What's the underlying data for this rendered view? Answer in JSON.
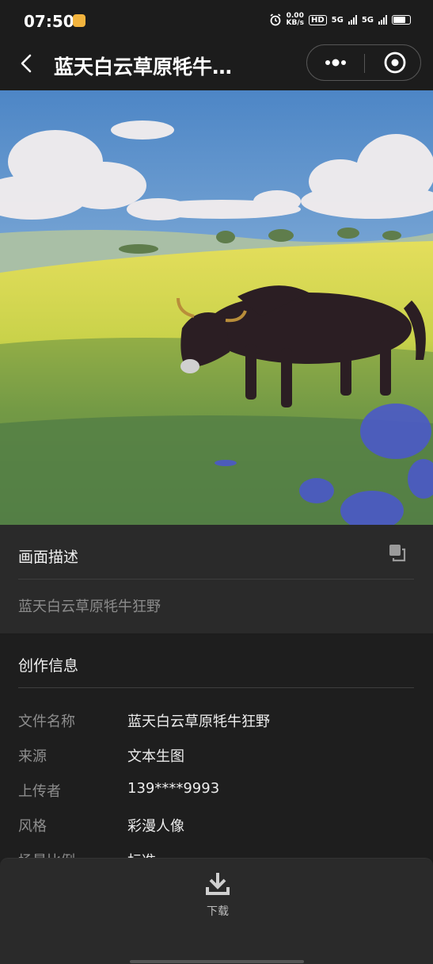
{
  "status": {
    "time": "07:50",
    "net_speed_value": "0.00",
    "net_speed_unit": "KB/s",
    "hd_label": "HD",
    "sim1": "5G",
    "sim2": "5G"
  },
  "nav": {
    "title": "蓝天白云草原牦牛…"
  },
  "description_card": {
    "title": "画面描述",
    "text": "蓝天白云草原牦牛狂野"
  },
  "info_card": {
    "title": "创作信息",
    "rows": [
      {
        "label": "文件名称",
        "value": "蓝天白云草原牦牛狂野"
      },
      {
        "label": "来源",
        "value": "文本生图"
      },
      {
        "label": "上传者",
        "value": "139****9993"
      },
      {
        "label": "风格",
        "value": "彩漫人像"
      },
      {
        "label": "场景比例",
        "value": "标准"
      }
    ]
  },
  "bottom_bar": {
    "download_label": "下载"
  },
  "colors": {
    "background": "#1c1c1c",
    "card": "#2a2a2a",
    "muted_text": "#8b8b8b"
  }
}
